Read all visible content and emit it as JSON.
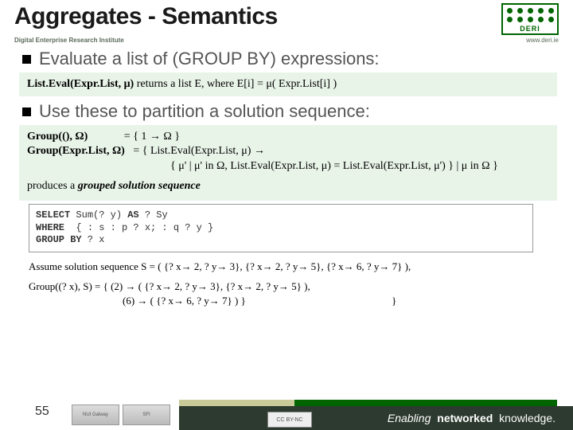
{
  "header": {
    "title": "Aggregates - Semantics",
    "org": "Digital Enterprise Research Institute",
    "url": "www.deri.ie",
    "logo_text": "DERI"
  },
  "bullet1": "Evaluate a list of (GROUP BY) expressions:",
  "box1": {
    "text": "List.Eval(Expr.List, μ) returns a list E, where E[i] = μ( Expr.List[i] )"
  },
  "bullet2": "Use these to partition a solution sequence:",
  "box2": {
    "line1a": "Group((), Ω)",
    "line1b": "= { 1 → Ω }",
    "line2a": "Group(Expr.List, Ω)",
    "line2b": "= { List.Eval(Expr.List, μ) →",
    "line3": "{ μ' | μ' in Ω, List.Eval(Expr.List, μ) = List.Eval(Expr.List, μ') } | μ in Ω }",
    "line4": "produces a grouped solution sequence"
  },
  "code": {
    "l1": "SELECT Sum(? y) AS ? Sy",
    "l2": "WHERE  { : s : p ? x; : q ? y }",
    "l3": "GROUP BY ? x"
  },
  "assume": "Assume solution sequence S = ( {? x→ 2, ? y→ 3}, {? x→ 2, ? y→ 5}, {? x→ 6, ? y→ 7} ),",
  "result": {
    "l1": "Group((? x), S) = {  (2) → ( {? x→ 2, ? y→ 3}, {? x→ 2, ? y→ 5} ),",
    "l2": "(6) → ( {? x→ 6, ? y→ 7} ) }",
    "brace": "}"
  },
  "footer": {
    "page": "55",
    "tagline_a": "Enabling",
    "tagline_b": "networked",
    "tagline_c": "knowledge.",
    "logo1": "NUI Galway",
    "logo2": "SFI",
    "cc": "CC BY-NC"
  }
}
